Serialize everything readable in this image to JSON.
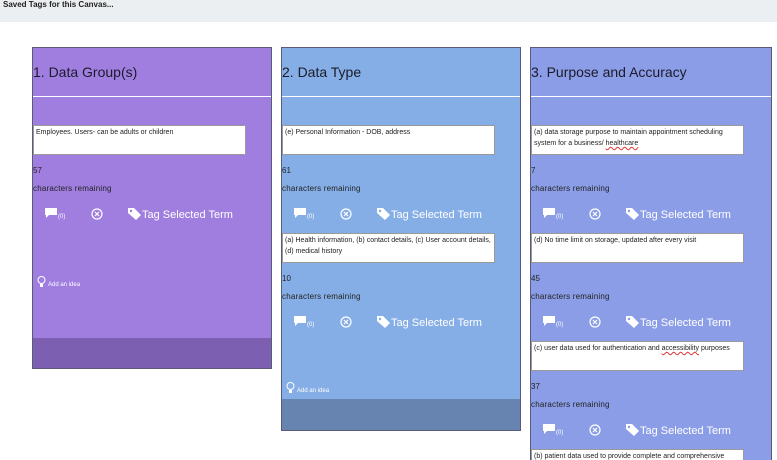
{
  "topbar": {
    "title": "Saved Tags for this Canvas..."
  },
  "common": {
    "remaining_label": "characters remaining",
    "tag_label": "Tag Selected Term",
    "comment_count": "(0)",
    "idea_label": "Add an idea"
  },
  "columns": [
    {
      "title": "1. Data Group(s)",
      "color": "#a07ee0",
      "footer_color": "#7c5fb0",
      "items": [
        {
          "text": "Employees. Users- can be adults or children",
          "count": "57"
        }
      ]
    },
    {
      "title": "2. Data Type",
      "color": "#86aee6",
      "footer_color": "#6784b0",
      "items": [
        {
          "text": "(e) Personal Information - DOB, address",
          "count": "61"
        },
        {
          "text": "(a) Health information, (b) contact details, (c) User account details, (d) medical history",
          "count": "10"
        }
      ]
    },
    {
      "title": "3. Purpose and Accuracy",
      "color": "#8b9de6",
      "items": [
        {
          "text_a": "(a) data storage purpose to maintain appointment scheduling system for a business/ ",
          "text_b": "healthcare",
          "count": "7"
        },
        {
          "text": "(d) No time limit on storage, updated after every visit",
          "count": "45"
        },
        {
          "text_a": "(c) user data used for authentication and ",
          "text_b": "accessibility",
          "text_c": " purposes",
          "count": "37"
        },
        {
          "text": "(b) patient data used to provide complete and comprehensive"
        }
      ]
    }
  ]
}
